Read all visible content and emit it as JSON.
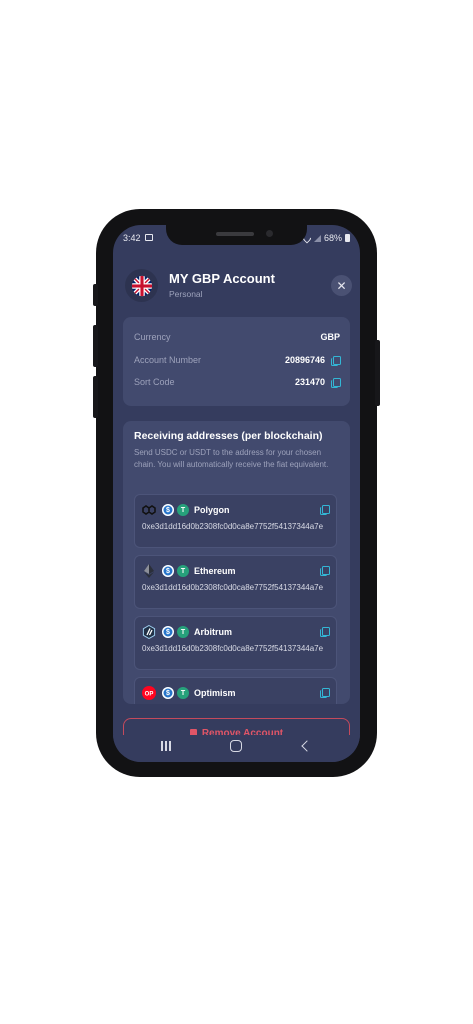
{
  "status_bar": {
    "time": "3:42",
    "battery": "68%",
    "icons": [
      "image-icon",
      "wifi-icon",
      "signal-icon",
      "battery-icon"
    ]
  },
  "header": {
    "title": "MY GBP Account",
    "subtitle": "Personal",
    "flag_icon": "uk-flag-icon",
    "close_icon": "close-icon"
  },
  "account_info": {
    "rows": [
      {
        "label": "Currency",
        "value": "GBP"
      },
      {
        "label": "Account Number",
        "value": "20896746"
      },
      {
        "label": "Sort Code",
        "value": "231470"
      }
    ]
  },
  "receiving": {
    "title": "Receiving addresses (per blockchain)",
    "description": "Send USDC or USDT to the address for your chosen chain. You will automatically receive the fiat equivalent.",
    "token_icons": [
      "usdc-icon",
      "usdt-icon"
    ],
    "chains": [
      {
        "name": "Polygon",
        "address": "0xe3d1dd16d0b2308fc0d0ca8e7752f54137344a7e"
      },
      {
        "name": "Ethereum",
        "address": "0xe3d1dd16d0b2308fc0d0ca8e7752f54137344a7e"
      },
      {
        "name": "Arbitrum",
        "address": "0xe3d1dd16d0b2308fc0d0ca8e7752f54137344a7e"
      },
      {
        "name": "Optimism",
        "address": ""
      }
    ]
  },
  "remove_button": {
    "label": "Remove Account"
  },
  "colors": {
    "background": "#353c5e",
    "card": "#424a6e",
    "accent": "#33b7d6",
    "danger": "#e05567"
  }
}
